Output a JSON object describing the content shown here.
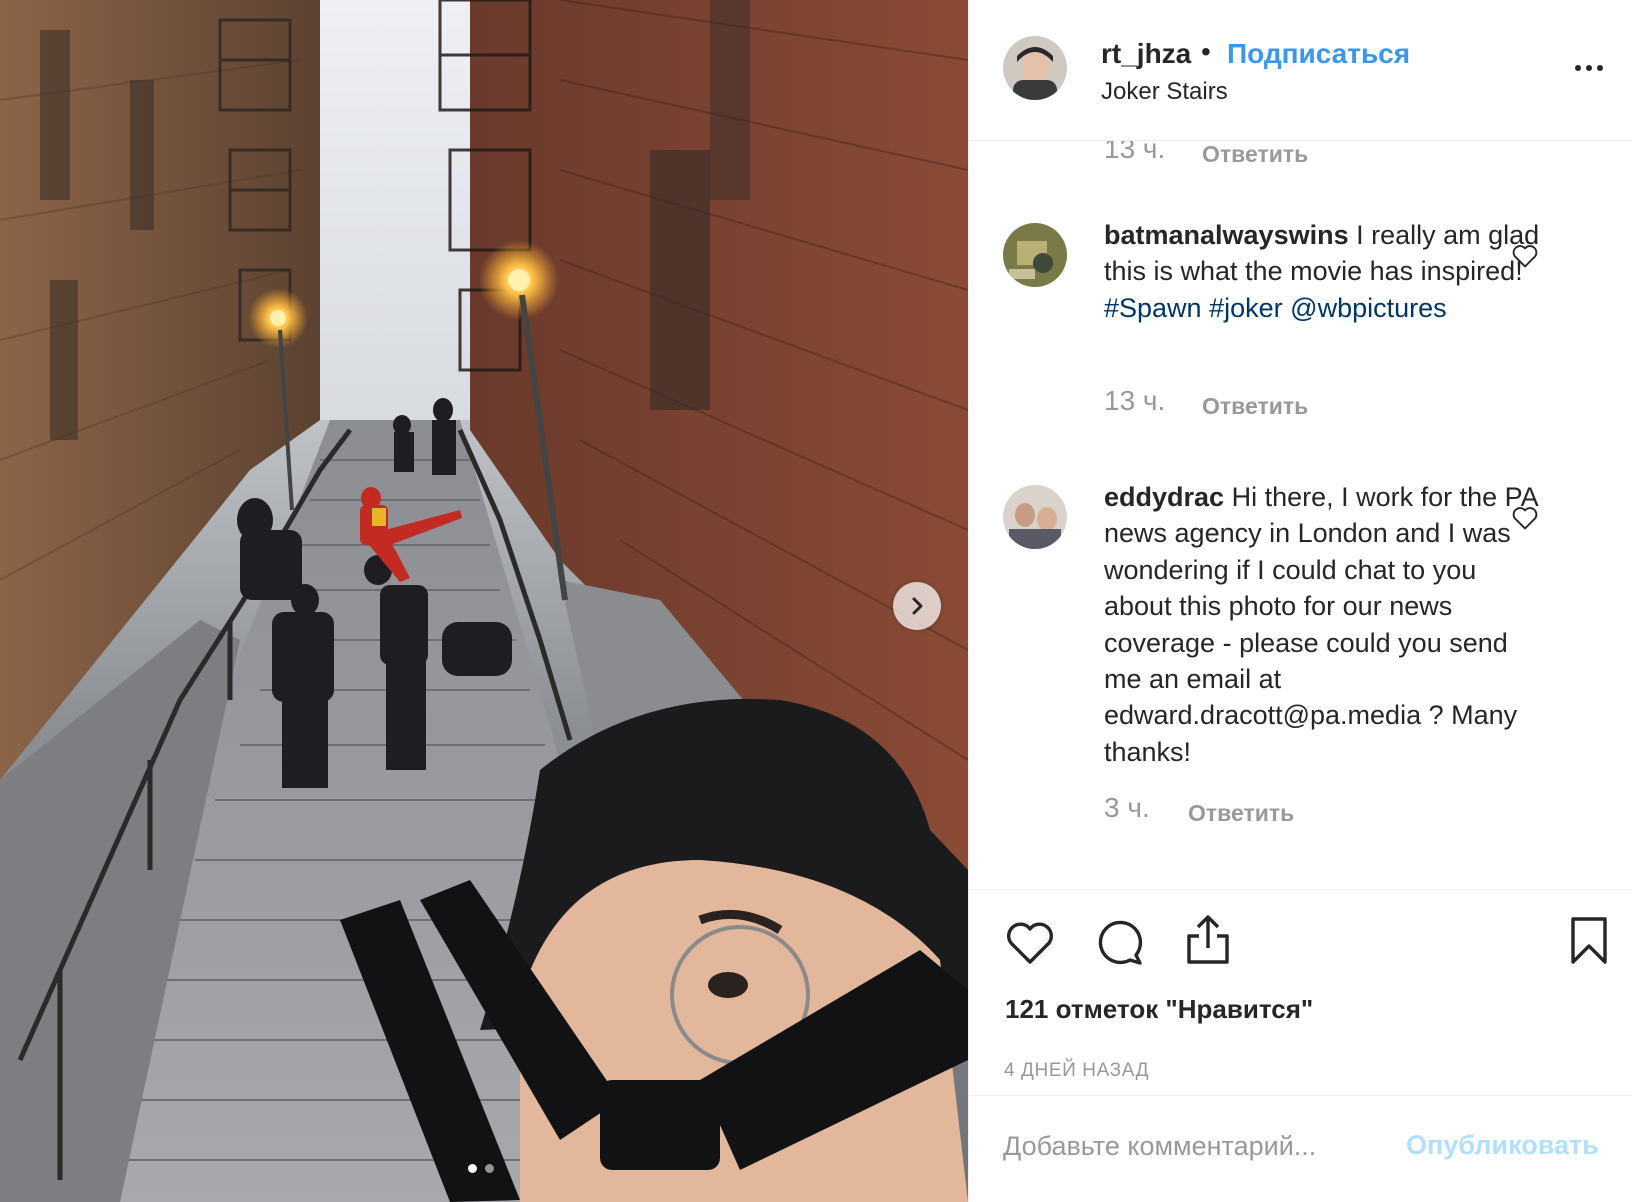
{
  "post": {
    "username": "rt_jhza",
    "bullet": "•",
    "follow_label": "Подписаться",
    "location": "Joker Stairs"
  },
  "comments": [
    {
      "username": "",
      "text": "",
      "time": "13 ч.",
      "reply_label": "Ответить"
    },
    {
      "username": "batmanalwayswins",
      "text_segments": [
        {
          "text": " I really am glad this is what the movie has inspired! ",
          "type": "plain"
        },
        {
          "text": "#Spawn",
          "type": "tag"
        },
        {
          "text": " ",
          "type": "plain"
        },
        {
          "text": "#joker",
          "type": "tag"
        },
        {
          "text": " ",
          "type": "plain"
        },
        {
          "text": "@wbpictures",
          "type": "tag"
        }
      ],
      "time": "13 ч.",
      "reply_label": "Ответить"
    },
    {
      "username": "eddydrac",
      "text_segments": [
        {
          "text": " Hi there, I work for the PA news agency in London and I was wondering if I could chat to you about this photo for our news coverage - please could you send me an email at edward.dracott@pa.media ? Many thanks!",
          "type": "plain"
        }
      ],
      "time": "3 ч.",
      "reply_label": "Ответить"
    }
  ],
  "actions": {
    "likes_text": "121 отметок \"Нравится\"",
    "date_text": "4 ДНЕЙ НАЗАД"
  },
  "add_comment": {
    "placeholder": "Добавьте комментарий...",
    "publish_label": "Опубликовать"
  },
  "carousel": {
    "current": 1,
    "total": 2
  },
  "colors": {
    "link_blue": "#3897f0",
    "hashtag_blue": "#003569",
    "muted_gray": "#999999",
    "text_dark": "#262626",
    "publish_disabled": "#b2dffc"
  },
  "icons": {
    "next": "chevron-right-icon",
    "like": "heart-icon",
    "comment": "comment-bubble-icon",
    "share": "share-icon",
    "save": "bookmark-icon",
    "more": "more-horizontal-icon"
  }
}
